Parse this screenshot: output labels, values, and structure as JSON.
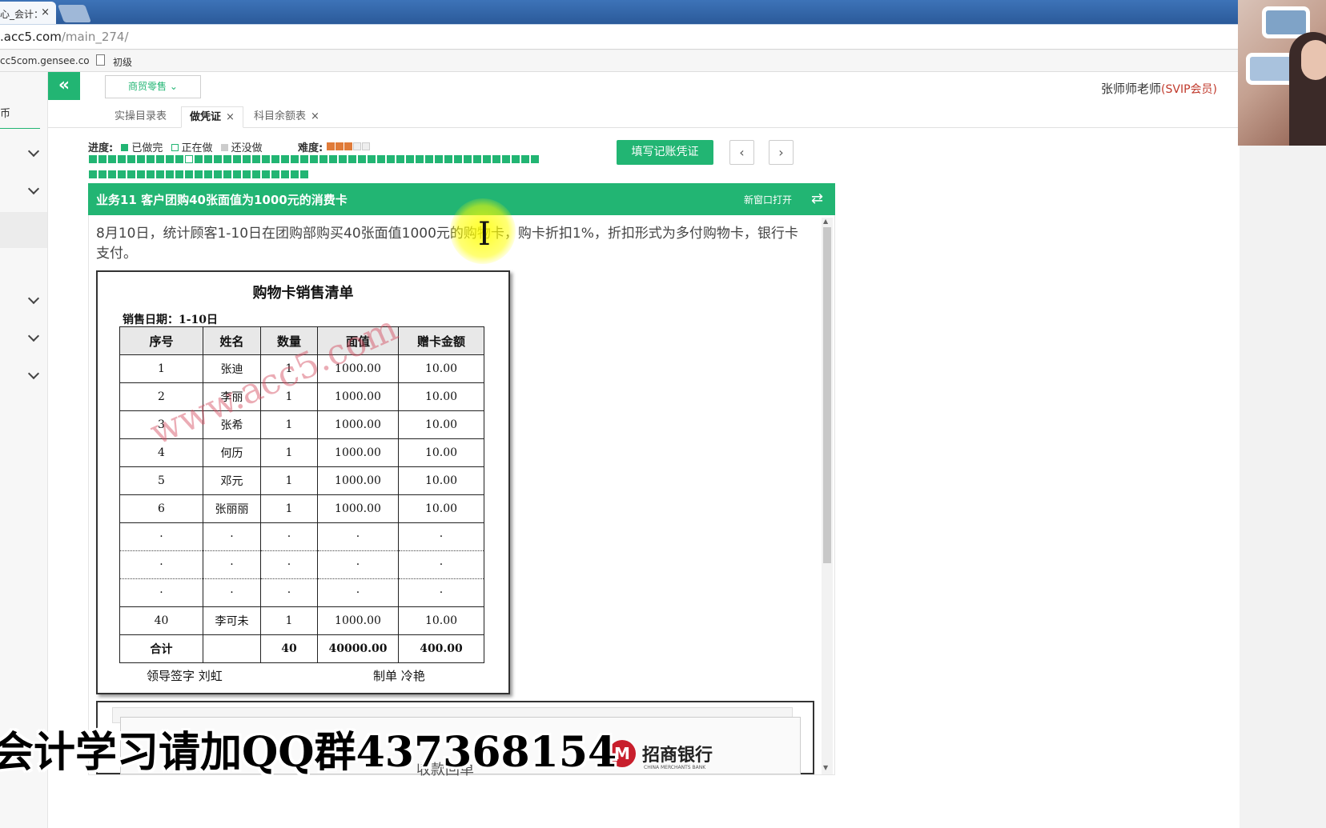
{
  "browser": {
    "tab_title": "心_会计：",
    "url_main": ".acc5.com",
    "url_path": "/main_274/",
    "bookmark1": "cc5com.gensee.co",
    "bookmark2": "初级"
  },
  "nav": {
    "partial_label": "币"
  },
  "header": {
    "collapse_icon": "«",
    "industry": "商贸零售",
    "user": "张师师老师",
    "vip": "(SVIP会员)"
  },
  "tabs": [
    {
      "label": "实操目录表",
      "closable": false
    },
    {
      "label": "做凭证",
      "closable": true
    },
    {
      "label": "科目余额表",
      "closable": true
    }
  ],
  "progress": {
    "label": "进度:",
    "done": "已做完",
    "doing": "正在做",
    "todo": "还没做",
    "difficulty_label": "难度:",
    "difficulty_stars": 3,
    "difficulty_max": 5,
    "cells_row1": 47,
    "cells_row2": 23,
    "current_index": 10,
    "colors": {
      "done": "#22b573",
      "doing": "#ffffff",
      "todo": "#cccccc"
    }
  },
  "actions": {
    "fill_voucher": "填写记账凭证",
    "prev": "‹",
    "next": "›"
  },
  "task": {
    "title": "业务11 客户团购40张面值为1000元的消费卡",
    "open_new": "新窗口打开",
    "swap_icon": "⇄",
    "description": "8月10日，统计顾客1-10日在团购部购买40张面值1000元的购物卡，购卡折扣1%，折扣形式为多付购物卡，银行卡支付。"
  },
  "document": {
    "title": "购物卡销售清单",
    "date": "销售日期：1-10日",
    "headers": [
      "序号",
      "姓名",
      "数量",
      "面值",
      "赠卡金额"
    ],
    "rows": [
      [
        "1",
        "张迪",
        "1",
        "1000.00",
        "10.00"
      ],
      [
        "2",
        "李丽",
        "1",
        "1000.00",
        "10.00"
      ],
      [
        "3",
        "张希",
        "1",
        "1000.00",
        "10.00"
      ],
      [
        "4",
        "何历",
        "1",
        "1000.00",
        "10.00"
      ],
      [
        "5",
        "邓元",
        "1",
        "1000.00",
        "10.00"
      ],
      [
        "6",
        "张丽丽",
        "1",
        "1000.00",
        "10.00"
      ],
      [
        "·",
        "·",
        "·",
        "·",
        "·"
      ],
      [
        "·",
        "·",
        "·",
        "·",
        "·"
      ],
      [
        "·",
        "·",
        "·",
        "·",
        "·"
      ],
      [
        "40",
        "李可未",
        "1",
        "1000.00",
        "10.00"
      ]
    ],
    "total": [
      "合计",
      "",
      "40",
      "40000.00",
      "400.00"
    ],
    "sign_left": "领导签字 刘虹",
    "sign_right": "制单 冷艳",
    "watermark": "www.acc5.com"
  },
  "document2": {
    "bank_logo": "M",
    "bank_name": "招商银行",
    "bank_en": "CHINA MERCHANTS BANK",
    "partial_text": "收款回单"
  },
  "overlay": {
    "caption": "会计学习请加QQ群437368154",
    "cursor": "I"
  }
}
